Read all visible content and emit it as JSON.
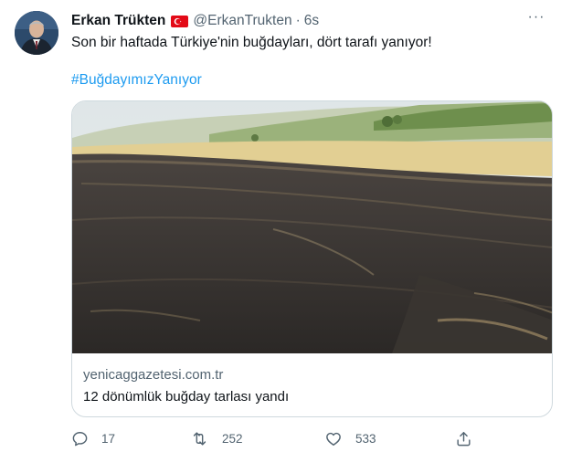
{
  "tweet": {
    "author_name": "Erkan Trükten",
    "handle": "@ErkanTrukten",
    "separator": "·",
    "time": "6s",
    "text": "Son bir haftada Türkiye'nin buğdayları, dört tarafı yanıyor!",
    "hashtag": "#BuğdayımızYanıyor"
  },
  "card": {
    "domain": "yenicaggazetesi.com.tr",
    "title": "12 dönümlük buğday tarlası yandı"
  },
  "actions": {
    "replies": "17",
    "retweets": "252",
    "likes": "533"
  },
  "icons": {
    "more": "more-icon",
    "reply": "reply-icon",
    "retweet": "retweet-icon",
    "like": "heart-icon",
    "share": "share-icon",
    "flag": "turkey-flag-icon"
  },
  "colors": {
    "link": "#1d9bf0",
    "secondary_text": "#536471",
    "flag_red": "#e30a17"
  }
}
